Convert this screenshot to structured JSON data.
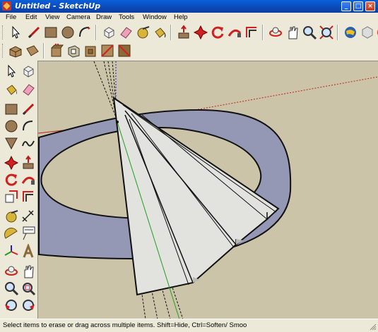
{
  "window": {
    "title": "Untitled - SketchUp",
    "minimize_glyph": "_",
    "maximize_glyph": "□",
    "close_glyph": "×"
  },
  "menubar": {
    "items": [
      "File",
      "Edit",
      "View",
      "Camera",
      "Draw",
      "Tools",
      "Window",
      "Help"
    ]
  },
  "toolbar_main": {
    "icons": [
      "select-icon",
      "line-icon",
      "rectangle-icon",
      "circle-icon",
      "arc-icon",
      "make-component-icon",
      "eraser-icon",
      "tape-measure-icon",
      "paint-bucket-icon",
      "push-pull-icon",
      "move-icon",
      "rotate-icon",
      "follow-me-icon",
      "offset-icon",
      "orbit-icon",
      "pan-icon",
      "zoom-icon",
      "zoom-extents-icon",
      "get-models-icon",
      "share-model-icon",
      "components-icon"
    ]
  },
  "toolbar_views": {
    "icons": [
      "iso-view-icon",
      "top-view-icon",
      "front-view-icon",
      "right-view-icon",
      "back-view-icon",
      "left-view-icon"
    ]
  },
  "toolbar_vertical": {
    "icons": [
      "select-icon",
      "make-component-icon",
      "paint-bucket-icon",
      "eraser-icon",
      "rectangle-icon",
      "line-icon",
      "circle-icon",
      "arc-icon",
      "polygon-icon",
      "freehand-icon",
      "move-icon",
      "push-pull-icon",
      "rotate-icon",
      "follow-me-icon",
      "scale-icon",
      "offset-icon",
      "tape-measure-icon",
      "dimension-icon",
      "protractor-icon",
      "text-icon",
      "axes-icon",
      "3d-text-icon",
      "orbit-icon",
      "pan-icon",
      "zoom-icon",
      "zoom-window-icon",
      "previous-view-icon",
      "next-view-icon"
    ]
  },
  "status": {
    "text": "Select items to erase or drag across multiple items. Shift=Hide, Ctrl=Soften/ Smoo"
  },
  "colors": {
    "viewport_bg": "#ccc4a8",
    "ring": "#9498b4",
    "face": "#e2e2df",
    "titlebar": "#0b4fc4"
  }
}
